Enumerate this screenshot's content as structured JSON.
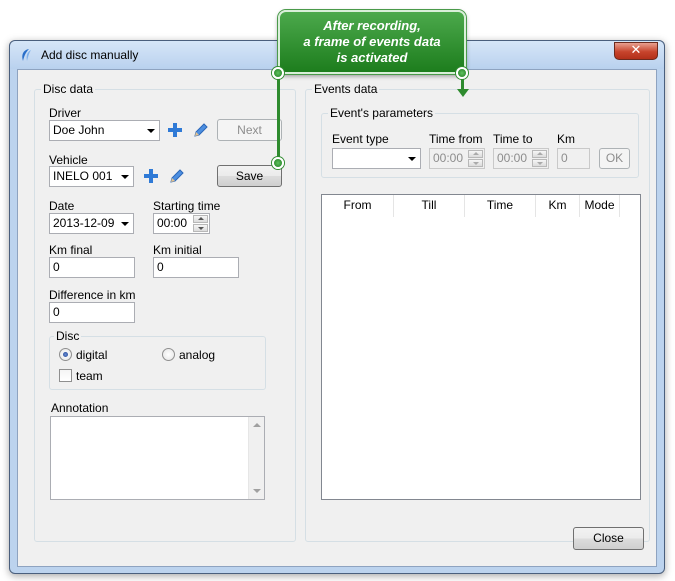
{
  "window": {
    "title": "Add disc manually",
    "close_glyph": "✕"
  },
  "callout": {
    "lines": [
      "After recording,",
      "a frame of events data",
      "is activated"
    ],
    "color": "#2e8b2e"
  },
  "disc_data": {
    "group_label": "Disc data",
    "driver_label": "Driver",
    "driver_value": "Doe John",
    "next_button": "Next",
    "vehicle_label": "Vehicle",
    "vehicle_value": "INELO 001",
    "save_button": "Save",
    "date_label": "Date",
    "date_value": "2013-12-09",
    "starting_time_label": "Starting time",
    "starting_time_value": "00:00",
    "km_final_label": "Km final",
    "km_final_value": "0",
    "km_initial_label": "Km initial",
    "km_initial_value": "0",
    "difference_label": "Difference in km",
    "difference_value": "0",
    "disc_group_label": "Disc",
    "digital_label": "digital",
    "analog_label": "analog",
    "team_label": "team",
    "annotation_label": "Annotation",
    "selected_disc_type": "digital",
    "team_checked": false
  },
  "events_data": {
    "group_label": "Events data",
    "params_label": "Event's parameters",
    "event_type_label": "Event type",
    "event_type_value": "",
    "time_from_label": "Time from",
    "time_from_value": "00:00",
    "time_to_label": "Time to",
    "time_to_value": "00:00",
    "km_label": "Km",
    "km_value": "0",
    "ok_button": "OK",
    "table_columns": [
      "From",
      "Till",
      "Time",
      "Km",
      "Mode"
    ],
    "table_rows": []
  },
  "footer": {
    "close_button": "Close"
  }
}
